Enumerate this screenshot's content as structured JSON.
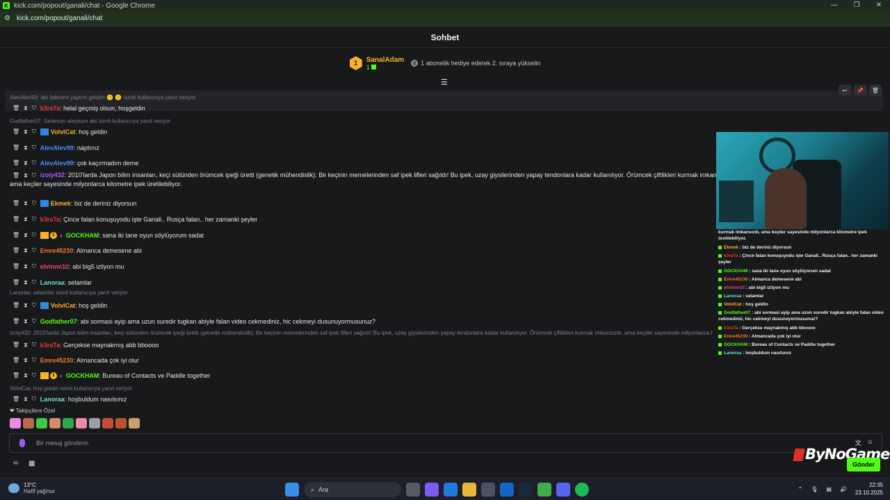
{
  "window": {
    "title": "kick.com/popout/ganali/chat - Google Chrome",
    "url": "kick.com/popout/ganali/chat",
    "favicon": "K"
  },
  "chat": {
    "header": "Sohbet",
    "top_gifter": {
      "rank": "1",
      "name": "SanalAdam",
      "count": "1",
      "info": "1 abonelik hediye ederek 2. sıraya yükselin"
    }
  },
  "messages": [
    {
      "reply": "AlevAlev99: abi ödevimi yaptım geldim 🙂 🙂 isimli kullanıcıya yanıt veriyor",
      "user": "k3raTa",
      "color": "#e53935",
      "text": ": helal geçmiş olsun, hoşgeldin"
    },
    {
      "reply": "Godfather07: Selamun aleykum abi isimli kullanıcıya yanıt veriyor",
      "user": "VolviCat",
      "color": "#f7b426",
      "text": ": hoş geldin"
    },
    {
      "user": "AlevAlev99",
      "color": "#4a8cff",
      "text": ": naptınız"
    },
    {
      "user": "AlevAlev99",
      "color": "#4a8cff",
      "text": ": çok kaçırmadım deme"
    },
    {
      "user": "izoly432",
      "color": "#a95cf5",
      "text": ": 2010'larda Japon bilim insanları, keçi sütünden örümcek ipeği üretti (genetik mühendislik): Bir keçinin memelerinden saf ipek lifleri sağıldı! Bu ipek, uzay giysilerinden yapay tendonlara kadar kullanılıyor. Örümcek çiftlikleri kurmak imkansızdı, ama keçiler sayesinde milyonlarca kilometre ipek üretilebiliyor."
    },
    {
      "user": "Ekmek",
      "color": "#f7b426",
      "text": ": biz de deriniz diyorsun"
    },
    {
      "user": "k3raTa",
      "color": "#e53935",
      "text": ": Çince falan konuşuyodu işte Ganali.. Rusça falan.. her zamanki şeyler"
    },
    {
      "user": "GOCKHAM",
      "color": "#53fc18",
      "text": ": sana iki tane oyun söylüyorum sadat"
    },
    {
      "user": "Emre45230",
      "color": "#f07a2a",
      "text": ": Almanca demesene abi"
    },
    {
      "user": "elvinnn10",
      "color": "#e0467c",
      "text": ": abi big5 izliyon mu"
    },
    {
      "user": "Lanoraa",
      "color": "#6fe0c8",
      "text": ": selamlar"
    },
    {
      "reply": "Lanoraa: selamlar isimli kullanıcıya yanıt veriyor",
      "user": "VolviCat",
      "color": "#f7b426",
      "text": ": hoş geldin"
    },
    {
      "user": "Godfather07",
      "color": "#53fc18",
      "text": ": abi sormasi ayip ama uzun suredir tugkan abiyle falan video cekmediniz, hic cekmeyi dusunuyormusunuz?"
    },
    {
      "reply": "izoly432: 2010'larda Japon bilim insanları, keçi sütünden örümcek ipeği üretti (genetik mühendislik): Bir keçinin memelerinden saf ipek lifleri sağıldı! Bu ipek, uzay giysilerinden yapay tendonlara kadar kullanılıyor. Örümcek çiftlikleri kurmak imkansızdı, ama keçiler sayesinde milyonlarca kilometre ipek üretilebiliyor.",
      "user": "k3raTa",
      "color": "#e53935",
      "text": ": Gerçekse maynakmış abb bboooo"
    },
    {
      "user": "Emre45230",
      "color": "#f07a2a",
      "text": ": Almancada çok iyi olur"
    },
    {
      "user": "GOCKHAM",
      "color": "#53fc18",
      "text": ": Bureau of Contacts ve Paddle together"
    },
    {
      "reply": "VolviCat: hoş geldin isimli kullanıcıya yanıt veriyor",
      "user": "Lanoraa",
      "color": "#6fe0c8",
      "text": ": hoşbuldum nasılsınız"
    }
  ],
  "emote_section": "Takipçilere Özel",
  "emote_colors": [
    "#e88be3",
    "#b86a4a",
    "#3cc94a",
    "#d98a6a",
    "#2fa54c",
    "#e98ba4",
    "#9aa0a8",
    "#c94a3a",
    "#b8552a",
    "#c8a070"
  ],
  "input": {
    "placeholder": "Bir mesaj gönderin",
    "send_label": "Gönder"
  },
  "overlay": {
    "brand": "ByNoGame",
    "lines": [
      {
        "text": "kurmak imkansızdı, ama keçiler sayesinde milyonlarca kilometre ipek üretilebiliyor."
      },
      {
        "user": "Ekmek",
        "color": "#f7b426",
        "text": " : biz de deriniz diyorsun"
      },
      {
        "user": "k3raTa",
        "color": "#e53935",
        "text": " : Çince falan konuşuyodu işte Ganali.. Rusça falan.. her zamanki şeyler"
      },
      {
        "user": "GOCKHAM",
        "color": "#53fc18",
        "text": " : sana iki tane oyun söylüyorum sadat"
      },
      {
        "user": "Emre45230",
        "color": "#f07a2a",
        "text": " : Almanca demesene abi"
      },
      {
        "user": "elvinnn10",
        "color": "#e0467c",
        "text": " : abi big5 izliyon mu"
      },
      {
        "user": "Lanoraa",
        "color": "#6fe0c8",
        "text": " : selamlar"
      },
      {
        "user": "VolviCat",
        "color": "#f7b426",
        "text": " : hoş geldin"
      },
      {
        "user": "Godfather07",
        "color": "#53fc18",
        "text": " : abi sormasi ayip ama uzun suredir tugkan abiyle falan video cekmediniz, hic cekmeyi dusunuyormusunuz?"
      },
      {
        "user": "k3raTa",
        "color": "#e53935",
        "text": " : Gerçekse maynakmış abb bboooo"
      },
      {
        "user": "Emre45230",
        "color": "#f07a2a",
        "text": " : Almancada çok iyi olur"
      },
      {
        "user": "GOCKHAM",
        "color": "#53fc18",
        "text": " : Bureau of Contacts ve Paddle together"
      },
      {
        "user": "Lanoraa",
        "color": "#6fe0c8",
        "text": " : hoşbuldum nasılsınız"
      }
    ]
  },
  "taskbar": {
    "temp": "13°C",
    "weather": "Hafif yağmur",
    "search": "Ara",
    "time": "22:35",
    "date": "23.10.2025"
  }
}
